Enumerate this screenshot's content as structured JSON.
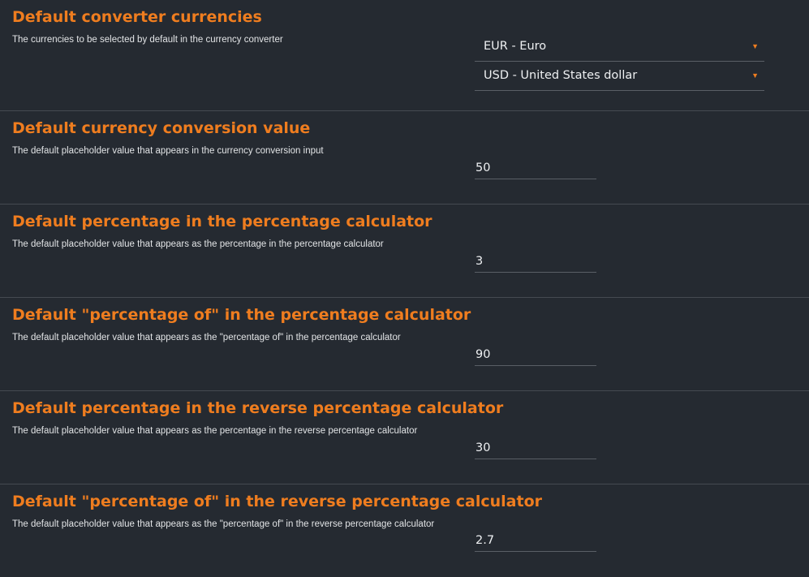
{
  "sections": [
    {
      "title": "Default converter currencies",
      "description": "The currencies to be selected by default in the currency converter",
      "selects": [
        {
          "value": "EUR - Euro"
        },
        {
          "value": "USD - United States dollar"
        }
      ]
    },
    {
      "title": "Default currency conversion value",
      "description": "The default placeholder value that appears in the currency conversion input",
      "value": "50"
    },
    {
      "title": "Default percentage in the percentage calculator",
      "description": "The default placeholder value that appears as the percentage in the percentage calculator",
      "value": "3"
    },
    {
      "title": "Default \"percentage of\" in the percentage calculator",
      "description": "The default placeholder value that appears as the \"percentage of\" in the percentage calculator",
      "value": "90"
    },
    {
      "title": "Default percentage in the reverse percentage calculator",
      "description": "The default placeholder value that appears as the percentage in the reverse percentage calculator",
      "value": "30"
    },
    {
      "title": "Default \"percentage of\" in the reverse percentage calculator",
      "description": "The default placeholder value that appears as the \"percentage of\" in the reverse percentage calculator",
      "value": "2.7"
    }
  ],
  "icons": {
    "dropdown_caret": "chevron-down-icon",
    "caret_glyph": "▼"
  },
  "colors": {
    "background": "#252a31",
    "accent": "#ef7d1f",
    "divider": "#454a51",
    "text": "#e6e8ea"
  }
}
